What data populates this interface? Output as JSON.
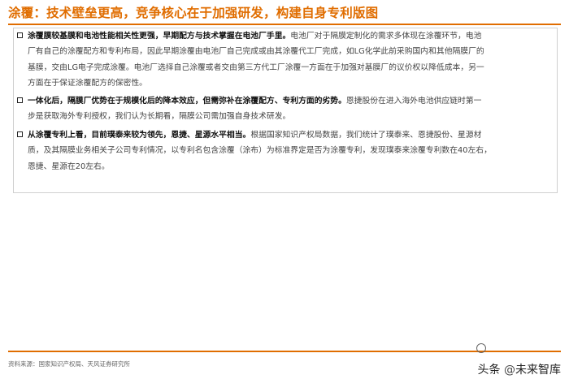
{
  "title": "涂覆：技术壁垒更高，竞争核心在于加强研发，构建自身专利版图",
  "bullets": [
    {
      "lead": "涂覆膜较基膜和电池性能相关性更强，早期配方与技术掌握在电池厂手里。",
      "lines": [
        "电池厂对于隔膜定制化的需求多体现在涂覆环节，电池",
        "厂有自己的涂覆配方和专利布局，因此早期涂覆由电池厂自己完成或由其涂覆代工厂完成，如LG化学此前采购国内和其他隔膜厂的",
        "基膜，交由LG电子完成涂覆。电池厂选择自己涂覆或者交由第三方代工厂涂覆一方面在于加强对基膜厂的议价权以降低成本，另一",
        "方面在于保证涂覆配方的保密性。"
      ]
    },
    {
      "lead": "一体化后，隔膜厂优势在于规模化后的降本效应，但需弥补在涂覆配方、专利方面的劣势。",
      "lines": [
        "恩捷股份在进入海外电池供应链时第一",
        "步是获取海外专利授权，我们认为长期看，隔膜公司需加强自身技术研发。"
      ]
    },
    {
      "lead": "从涂覆专利上看，目前璞泰来较为领先，恩捷、星源水平相当。",
      "lines": [
        "根据国家知识产权局数据，我们统计了璞泰来、恩捷股份、星源材",
        "质，及其隔膜业务相关子公司专利情况，以专利名包含涂覆（涂布）为标准界定是否为涂覆专利，发现璞泰来涂覆专利数在40左右，",
        "恩捷、星源在20左右。"
      ]
    }
  ],
  "footer": {
    "source": "资料来源：国家知识产权局、天风证券研究所"
  },
  "watermark": {
    "prefix": "头条",
    "at": "@",
    "name": "未来智库"
  },
  "colors": {
    "accent": "#e06d00",
    "text": "#444444",
    "lead": "#111111"
  },
  "icons": {
    "bullet": "hollow-square-icon",
    "watermark_logo": "toutiao-logo-icon"
  }
}
